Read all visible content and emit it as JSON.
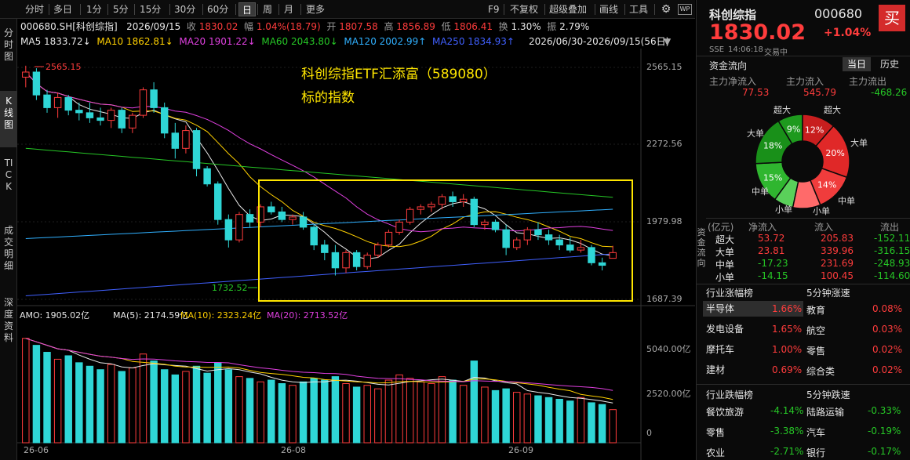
{
  "topbar": {
    "periods": [
      "分时",
      "多日",
      "1分",
      "5分",
      "15分",
      "30分",
      "60分",
      "日",
      "周",
      "月",
      "更多"
    ],
    "active_period": "日",
    "right_items": [
      "F9",
      "不复权",
      "超级叠加",
      "画线",
      "工具"
    ],
    "settings_icon": "gear-icon",
    "wp_icon": "WP"
  },
  "leftnav": {
    "items": [
      "分时图",
      "K线图",
      "TICK",
      "成交明细",
      "深度资料"
    ],
    "active": "K线图"
  },
  "info": {
    "code": "000680.SH[科创综指]",
    "date": "2026/09/15",
    "close_label": "收",
    "close": "1830.02",
    "change_label": "幅",
    "change": "1.04%(18.79)",
    "open_label": "开",
    "open": "1807.58",
    "high_label": "高",
    "high": "1856.89",
    "low_label": "低",
    "low": "1806.41",
    "turnover_label": "换",
    "turnover": "1.30%",
    "amplitude_label": "振",
    "amplitude": "2.79%"
  },
  "ma": {
    "items": [
      {
        "label": "MA5",
        "value": "1833.72↓",
        "color": "#e8e8e8"
      },
      {
        "label": "MA10",
        "value": "1862.81↓",
        "color": "#ffd000"
      },
      {
        "label": "MA20",
        "value": "1901.22↓",
        "color": "#e040e0"
      },
      {
        "label": "MA60",
        "value": "2043.80↓",
        "color": "#26c726"
      },
      {
        "label": "MA120",
        "value": "2002.99↑",
        "color": "#30b0ff"
      },
      {
        "label": "MA250",
        "value": "1834.93↑",
        "color": "#4060ff"
      }
    ],
    "range": "2026/06/30-2026/09/15(56日)"
  },
  "chart": {
    "y_ticks": [
      "2565.15",
      "2272.56",
      "1979.98",
      "1687.39"
    ],
    "max_label": "2565.15",
    "min_label": "1732.52",
    "annotation_line1": "科创综指ETF汇添富（589080）",
    "annotation_line2": "标的指数",
    "x_ticks": [
      "26-06",
      "26-08",
      "26-09"
    ]
  },
  "volume": {
    "title": "AMO: 1905.02亿",
    "ma5": "MA(5): 2174.59亿",
    "ma10": "MA(10): 2323.24亿",
    "ma20": "MA(20): 2713.52亿",
    "y_ticks": [
      "5040.00亿",
      "2520.00亿",
      "0"
    ]
  },
  "chart_data": {
    "type": "candlestick",
    "title": "000680.SH[科创综指]",
    "ylim": [
      1640,
      2620
    ],
    "candles": [
      [
        2520,
        2565,
        2480,
        2540
      ],
      [
        2540,
        2555,
        2430,
        2450
      ],
      [
        2450,
        2470,
        2380,
        2400
      ],
      [
        2400,
        2460,
        2360,
        2440
      ],
      [
        2440,
        2450,
        2370,
        2390
      ],
      [
        2390,
        2420,
        2350,
        2380
      ],
      [
        2380,
        2420,
        2340,
        2360
      ],
      [
        2360,
        2400,
        2330,
        2350
      ],
      [
        2350,
        2400,
        2320,
        2390
      ],
      [
        2390,
        2400,
        2300,
        2320
      ],
      [
        2320,
        2380,
        2300,
        2370
      ],
      [
        2370,
        2480,
        2360,
        2470
      ],
      [
        2470,
        2500,
        2380,
        2400
      ],
      [
        2400,
        2420,
        2280,
        2300
      ],
      [
        2300,
        2340,
        2200,
        2240
      ],
      [
        2240,
        2330,
        2220,
        2310
      ],
      [
        2310,
        2320,
        2130,
        2160
      ],
      [
        2160,
        2170,
        2090,
        2100
      ],
      [
        2100,
        2110,
        1940,
        1960
      ],
      [
        1960,
        1980,
        1850,
        1880
      ],
      [
        1880,
        1990,
        1870,
        1980
      ],
      [
        1980,
        2000,
        1930,
        1950
      ],
      [
        1950,
        2020,
        1930,
        2010
      ],
      [
        2010,
        2030,
        1980,
        1990
      ],
      [
        1990,
        2010,
        1950,
        1960
      ],
      [
        1960,
        1980,
        1940,
        1970
      ],
      [
        1970,
        1990,
        1920,
        1930
      ],
      [
        1930,
        1940,
        1840,
        1860
      ],
      [
        1860,
        1880,
        1800,
        1830
      ],
      [
        1830,
        1860,
        1740,
        1770
      ],
      [
        1770,
        1840,
        1750,
        1830
      ],
      [
        1830,
        1840,
        1760,
        1775
      ],
      [
        1775,
        1830,
        1765,
        1820
      ],
      [
        1820,
        1870,
        1810,
        1860
      ],
      [
        1860,
        1920,
        1850,
        1910
      ],
      [
        1910,
        1960,
        1900,
        1950
      ],
      [
        1950,
        2010,
        1940,
        2000
      ],
      [
        2000,
        2020,
        1980,
        2010
      ],
      [
        2010,
        2030,
        1990,
        2020
      ],
      [
        2020,
        2060,
        2000,
        2050
      ],
      [
        2050,
        2070,
        2010,
        2030
      ],
      [
        2030,
        2060,
        2010,
        2040
      ],
      [
        2040,
        2050,
        1930,
        1940
      ],
      [
        1940,
        1960,
        1920,
        1950
      ],
      [
        1950,
        1960,
        1910,
        1920
      ],
      [
        1920,
        1940,
        1820,
        1850
      ],
      [
        1850,
        1890,
        1840,
        1880
      ],
      [
        1880,
        1930,
        1860,
        1920
      ],
      [
        1920,
        1950,
        1880,
        1900
      ],
      [
        1900,
        1920,
        1860,
        1880
      ],
      [
        1880,
        1900,
        1840,
        1860
      ],
      [
        1860,
        1890,
        1830,
        1840
      ],
      [
        1840,
        1880,
        1830,
        1850
      ],
      [
        1850,
        1860,
        1780,
        1790
      ],
      [
        1790,
        1810,
        1760,
        1780
      ],
      [
        1807.58,
        1856.89,
        1806.41,
        1830.02
      ]
    ],
    "volumes": [
      6000,
      5600,
      5200,
      4800,
      5000,
      4600,
      4400,
      4200,
      4500,
      4100,
      4300,
      5100,
      4700,
      4200,
      3900,
      4100,
      4400,
      4000,
      4600,
      4200,
      3800,
      3700,
      3500,
      3600,
      3400,
      3300,
      3500,
      3700,
      3600,
      3800,
      3400,
      3200,
      3300,
      3100,
      3600,
      3900,
      3700,
      3500,
      3400,
      3800,
      3600,
      3300,
      4700,
      3200,
      3000,
      3100,
      2900,
      2800,
      2700,
      2600,
      2500,
      2400,
      2600,
      2300,
      2200,
      1905
    ]
  },
  "right": {
    "name": "科创综指",
    "code": "000680",
    "price": "1830.02",
    "change_pct": "+1.04%",
    "exchange": "SSE",
    "time": "14:06:18",
    "status": "交易中",
    "buy_label": "买",
    "capital_flow_title": "资金流向",
    "tab_day": "当日",
    "tab_history": "历史",
    "flow_headers": [
      "主力净流入",
      "主力流入",
      "主力流出"
    ],
    "flow_values": [
      "77.53",
      "545.79",
      "-468.26"
    ],
    "pie_labels": {
      "super_in": "超大",
      "super_out": "超大",
      "big_in": "大单",
      "big_out": "大单",
      "mid_in": "中单",
      "mid_out": "中单",
      "small_in": "小单",
      "small_out": "小单"
    },
    "pie_slices": [
      {
        "label": "9%",
        "value": 9,
        "color": "#1e9a1e"
      },
      {
        "label": "12%",
        "value": 12,
        "color": "#c81e1e"
      },
      {
        "label": "20%",
        "value": 20,
        "color": "#e02828"
      },
      {
        "label": "14%",
        "value": 14,
        "color": "#f03c3c"
      },
      {
        "label": "",
        "value": 10,
        "color": "#ff6a6a"
      },
      {
        "label": "",
        "value": 7,
        "color": "#5ad05a"
      },
      {
        "label": "15%",
        "value": 15,
        "color": "#2fb62f"
      },
      {
        "label": "18%",
        "value": 18,
        "color": "#199019"
      }
    ],
    "table_unit": "(亿元)",
    "table_headers": [
      "净流入",
      "流入",
      "流出"
    ],
    "table_rows": [
      {
        "name": "超大",
        "net": "53.72",
        "in": "205.83",
        "out": "-152.11"
      },
      {
        "name": "大单",
        "net": "23.81",
        "in": "339.96",
        "out": "-316.15"
      },
      {
        "name": "中单",
        "net": "-17.23",
        "in": "231.69",
        "out": "-248.93"
      },
      {
        "name": "小单",
        "net": "-14.15",
        "in": "100.45",
        "out": "-114.60"
      }
    ],
    "side_label": "资金流向",
    "rise_title": "行业涨幅榜",
    "rise5_title": "5分钟涨速",
    "rise_rows": [
      {
        "a": "半导体",
        "av": "1.66%",
        "b": "教育",
        "bv": "0.08%"
      },
      {
        "a": "发电设备",
        "av": "1.65%",
        "b": "航空",
        "bv": "0.03%"
      },
      {
        "a": "摩托车",
        "av": "1.00%",
        "b": "零售",
        "bv": "0.02%"
      },
      {
        "a": "建材",
        "av": "0.69%",
        "b": "综合类",
        "bv": "0.02%"
      }
    ],
    "fall_title": "行业跌幅榜",
    "fall5_title": "5分钟跌速",
    "fall_rows": [
      {
        "a": "餐饮旅游",
        "av": "-4.14%",
        "b": "陆路运输",
        "bv": "-0.33%"
      },
      {
        "a": "零售",
        "av": "-3.38%",
        "b": "汽车",
        "bv": "-0.19%"
      },
      {
        "a": "农业",
        "av": "-2.71%",
        "b": "银行",
        "bv": "-0.17%"
      }
    ]
  }
}
